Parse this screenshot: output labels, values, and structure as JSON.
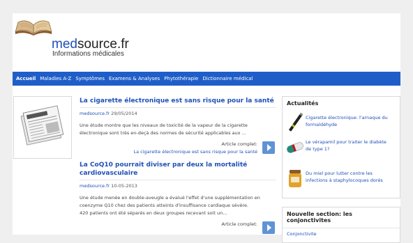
{
  "header": {
    "site_name_prefix": "med",
    "site_name_suffix": "source.fr",
    "tagline": "Informations médicales"
  },
  "nav": {
    "items": [
      {
        "label": "Accueil"
      },
      {
        "label": "Maladies A-Z"
      },
      {
        "label": "Symptômes"
      },
      {
        "label": "Examens & Analyses"
      },
      {
        "label": "Phytothérapie"
      },
      {
        "label": "Dictionnaire médical"
      }
    ]
  },
  "articles": [
    {
      "title": "La cigarette électronique est sans risque pour la santé",
      "source": "medsource.fr",
      "date": "29/05/2014",
      "body": "Une étude montre que les niveaux de toxicité de la vapeur de la cigarette électronique sont très en-deçà des normes de sécurité applicables aux ...",
      "more_label": "Article complet:",
      "more_link": "La cigarette électronique est sans risque pour la santé"
    },
    {
      "title": "La CoQ10 pourrait diviser par deux la mortalité cardiovasculaire",
      "source": "medsource.fr",
      "date": "10-05-2013",
      "body": "Une étude menée en double-aveugle a évalué l'effet d'une supplémentation en coenzyme Q10 chez des patients atteints d'insuffisance cardiaque sévère.\n420 patients ont été séparés en deux groupes recevant soit un...",
      "more_label": "Article complet:",
      "more_link": ""
    }
  ],
  "sidebar": {
    "actualites_title": "Actualités",
    "actualites": [
      {
        "label": "Cigarette électronique: l'arnaque du formaldéhyde",
        "icon": "e-cigarette-icon"
      },
      {
        "label": "Le vérapamil pour traiter le diabète de type 1?",
        "icon": "pill-icon"
      },
      {
        "label": "Du miel pour lutter contre les infections à staphylocoques dorés",
        "icon": "honey-jar-icon"
      }
    ],
    "section_title": "Nouvelle section: les conjonctivites",
    "section_link": "Conjonctivite"
  },
  "colors": {
    "nav_bg": "#1f5ec8",
    "link": "#1f4fb8",
    "button": "#5f93d6"
  }
}
